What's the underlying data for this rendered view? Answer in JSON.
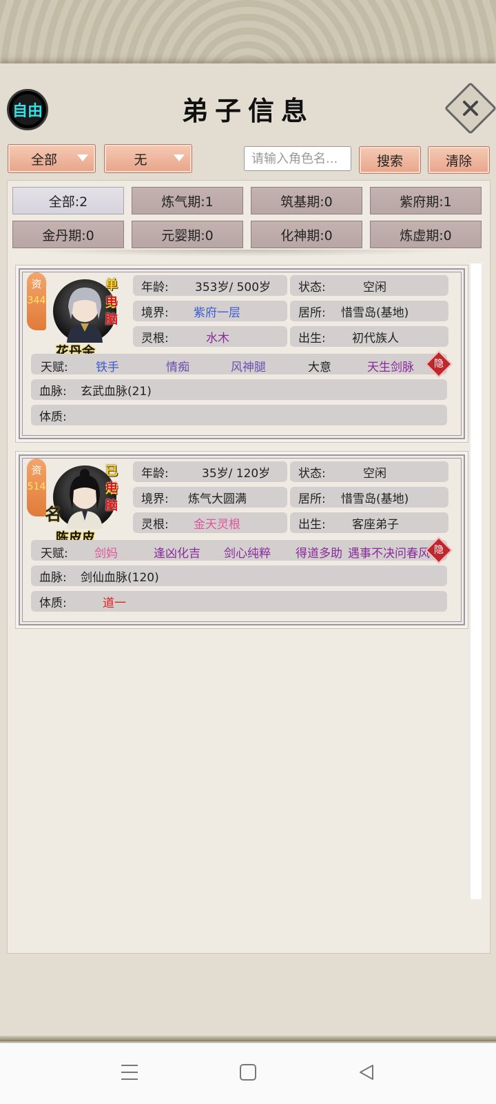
{
  "header": {
    "free_label": "自由",
    "title": "弟子信息",
    "close_icon": "close-icon"
  },
  "filters": {
    "dropdown1": "全部",
    "dropdown2": "无",
    "search_placeholder": "请输入角色名...",
    "search_label": "搜索",
    "clear_label": "清除"
  },
  "stages": [
    {
      "label": "全部:2",
      "active": true
    },
    {
      "label": "炼气期:1"
    },
    {
      "label": "筑基期:0"
    },
    {
      "label": "紫府期:1"
    },
    {
      "label": "金丹期:0"
    },
    {
      "label": "元婴期:0"
    },
    {
      "label": "化神期:0"
    },
    {
      "label": "炼虚期:0"
    }
  ],
  "disciples": [
    {
      "aptitude_label": "资",
      "aptitude_value": "344",
      "marital": "单身",
      "controller": "电脑",
      "name": "花丹余",
      "age_label": "年龄:",
      "age_value": "353岁/ 500岁",
      "status_label": "状态:",
      "status_value": "空闲",
      "realm_label": "境界:",
      "realm_value": "紫府一层",
      "residence_label": "居所:",
      "residence_value": "惜雪岛(基地)",
      "root_label": "灵根:",
      "root_value": "水木",
      "origin_label": "出生:",
      "origin_value": "初代族人",
      "talent_label": "天赋:",
      "talents": [
        "铁手",
        "情痴",
        "风神腿",
        "大意",
        "天生剑脉"
      ],
      "hide_label": "隐",
      "bloodline_label": "血脉:",
      "bloodline_value": "玄武血脉(21)",
      "constitution_label": "体质:",
      "constitution_value": ""
    },
    {
      "aptitude_label": "资",
      "aptitude_value": "514",
      "marital": "已婚",
      "controller": "电脑",
      "fame": "名",
      "name": "陈皮皮",
      "age_label": "年龄:",
      "age_value": "35岁/ 120岁",
      "status_label": "状态:",
      "status_value": "空闲",
      "realm_label": "境界:",
      "realm_value": "炼气大圆满",
      "residence_label": "居所:",
      "residence_value": "惜雪岛(基地)",
      "root_label": "灵根:",
      "root_value": "金天灵根",
      "origin_label": "出生:",
      "origin_value": "客座弟子",
      "talent_label": "天赋:",
      "talents": [
        "剑妈",
        "逢凶化吉",
        "剑心纯粹",
        "得道多助",
        "遇事不决问春风"
      ],
      "hide_label": "隐",
      "bloodline_label": "血脉:",
      "bloodline_value": "剑仙血脉(120)",
      "constitution_label": "体质:",
      "constitution_value": "道一"
    }
  ],
  "system_nav": {
    "menu_icon": "menu-icon",
    "home_icon": "home-icon",
    "back_icon": "back-icon"
  }
}
